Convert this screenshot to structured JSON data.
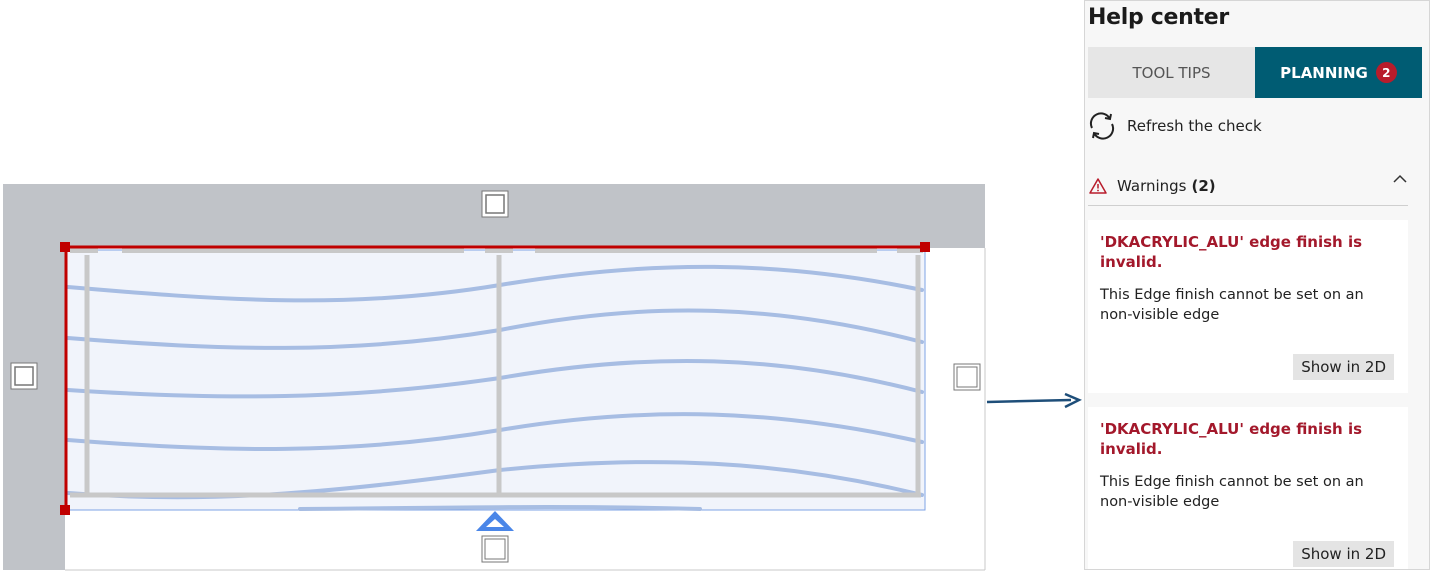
{
  "help_center": {
    "title": "Help center",
    "tabs": [
      {
        "label": "TOOL TIPS",
        "active": false
      },
      {
        "label": "PLANNING",
        "active": true,
        "badge": "2"
      }
    ],
    "refresh_label": "Refresh the check",
    "warnings": {
      "label": "Warnings",
      "count": "(2)",
      "expanded": true,
      "items": [
        {
          "title": "'DKACRYLIC_ALU' edge finish is invalid.",
          "message": "This Edge finish cannot be set on an non-visible edge",
          "action": "Show in 2D"
        },
        {
          "title": "'DKACRYLIC_ALU' edge finish is invalid.",
          "message": "This Edge finish cannot be set on an non-visible edge",
          "action": "Show in 2D"
        }
      ]
    }
  },
  "colors": {
    "primary_tab": "#005c73",
    "badge": "#b81c2b",
    "error_text": "#a3182b",
    "selection_red": "#c00000",
    "wood_grain": "#a7bde3",
    "wall_gray": "#c0c3c8"
  }
}
